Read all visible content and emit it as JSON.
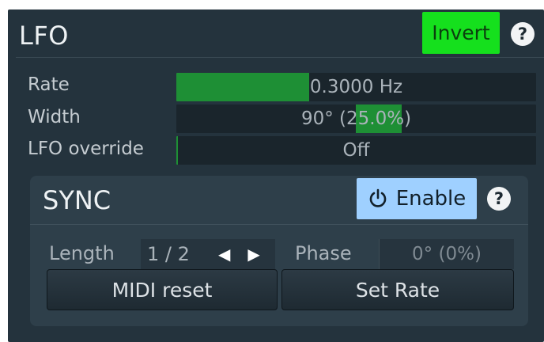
{
  "lfo": {
    "title": "LFO",
    "invert_label": "Invert",
    "help_label": "?",
    "rows": [
      {
        "label": "Rate",
        "value": "0.3000 Hz",
        "fill_fraction": 0.37
      },
      {
        "label": "Width",
        "value": "90° (25.0%)",
        "fill_fraction_start": 0.5,
        "fill_fraction_end": 0.63
      },
      {
        "label": "LFO override",
        "value": "Off",
        "fill_fraction": 0.0
      }
    ]
  },
  "sync": {
    "title": "SYNC",
    "enable_label": "Enable",
    "help_label": "?",
    "length_label": "Length",
    "length_value": "1 / 2",
    "phase_label": "Phase",
    "phase_value": "0° (0%)",
    "midi_reset_label": "MIDI reset",
    "set_rate_label": "Set Rate"
  },
  "colors": {
    "invert_active": "#15e01d",
    "enable_active": "#9fd0ff",
    "slider_fill": "#1e8f35"
  }
}
